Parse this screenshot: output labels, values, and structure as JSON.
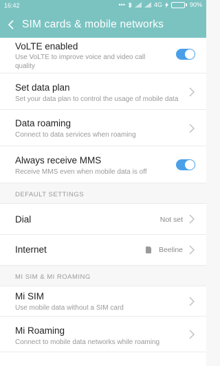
{
  "status_bar": {
    "time": "16:42",
    "network": "4G",
    "battery_percent": "90%",
    "battery_level": 0.9,
    "icons": [
      "dots-icon",
      "bluetooth-icon",
      "signal-icon",
      "signal-icon",
      "charging-icon"
    ]
  },
  "header": {
    "title": "SIM cards & mobile networks"
  },
  "rows": {
    "volte": {
      "title": "VoLTE enabled",
      "subtitle_line1": "Use VoLTE to improve voice and video call",
      "subtitle_line2": "quality",
      "enabled": true
    },
    "data_plan": {
      "title": "Set data plan",
      "subtitle": "Set your data plan to control the usage of mobile data"
    },
    "roaming": {
      "title": "Data roaming",
      "subtitle": "Connect to data services when roaming"
    },
    "mms": {
      "title": "Always receive MMS",
      "subtitle": "Receive MMS even when mobile data is off",
      "enabled": true
    },
    "dial": {
      "title": "Dial",
      "value": "Not set"
    },
    "internet": {
      "title": "Internet",
      "value": "Beeline"
    },
    "mi_sim": {
      "title": "Mi SIM",
      "subtitle": "Use mobile data without a SIM card"
    },
    "mi_roaming": {
      "title": "Mi Roaming",
      "subtitle": "Connect to mobile data networks while roaming"
    }
  },
  "sections": {
    "default": "DEFAULT SETTINGS",
    "mi": "MI SIM & MI ROAMING"
  },
  "colors": {
    "accent": "#7ac3c1",
    "toggle_on": "#4aa0e8",
    "battery": "#4caf50"
  }
}
